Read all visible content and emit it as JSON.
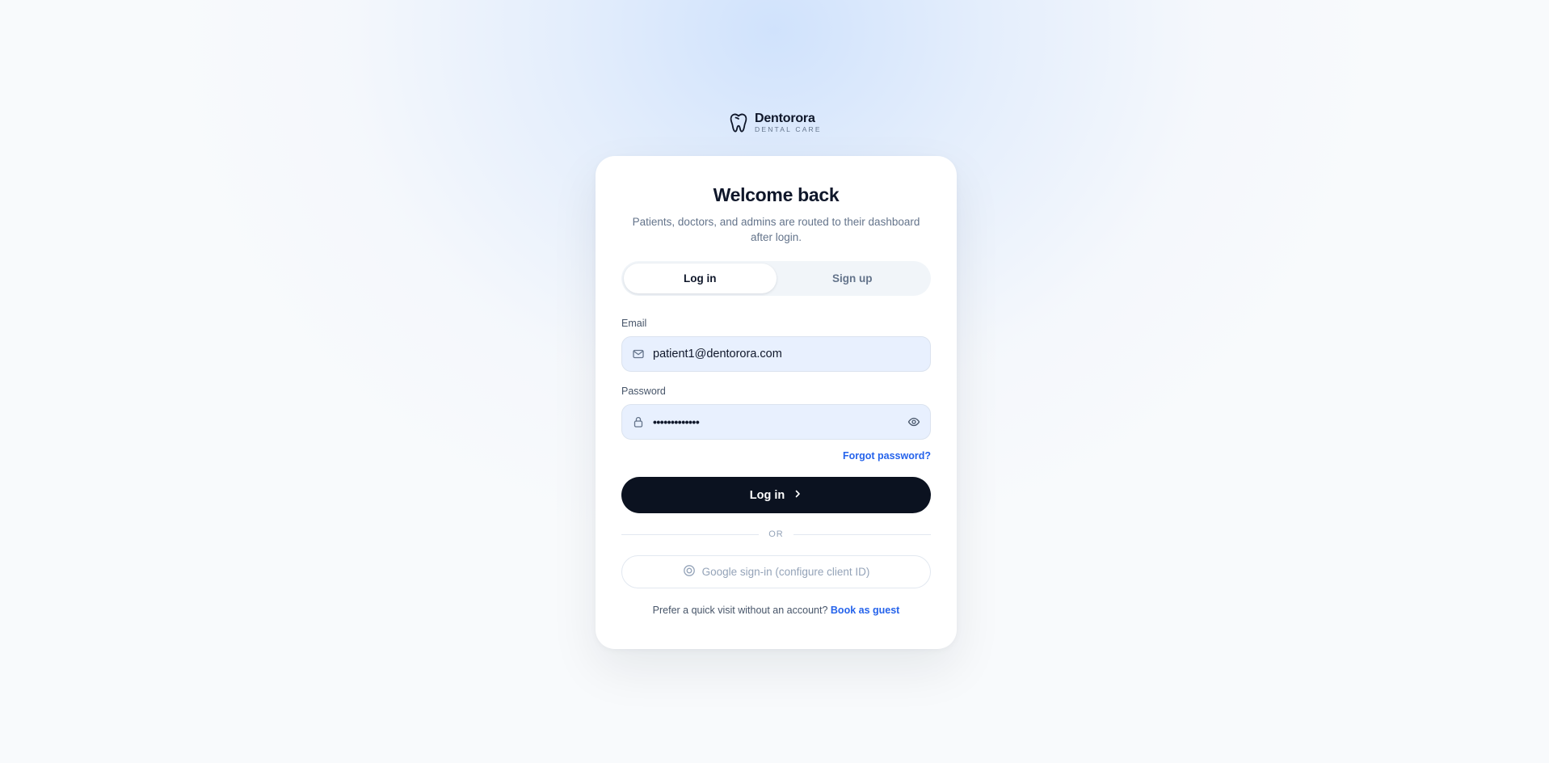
{
  "brand": {
    "name": "Dentorora",
    "tagline": "DENTAL CARE"
  },
  "card": {
    "title": "Welcome back",
    "subtitle": "Patients, doctors, and admins are routed to their dashboard after login."
  },
  "tabs": [
    {
      "label": "Log in",
      "active": true
    },
    {
      "label": "Sign up",
      "active": false
    }
  ],
  "form": {
    "email": {
      "label": "Email",
      "value": "patient1@dentorora.com"
    },
    "password": {
      "label": "Password",
      "masked": "•••••••••••••"
    },
    "forgot_label": "Forgot password?",
    "submit_label": "Log in"
  },
  "divider_label": "OR",
  "google_label": "Google sign-in (configure client ID)",
  "guest": {
    "prompt": "Prefer a quick visit without an account? ",
    "link_label": "Book as guest"
  },
  "colors": {
    "primary": "#0b1220",
    "accent": "#2563eb",
    "input_bg": "#e8f0fe"
  },
  "icons": {
    "brand": "tooth-icon",
    "email": "mail-icon",
    "password": "lock-icon",
    "toggle": "eye-icon",
    "submit": "chevron-right-icon",
    "google": "google-icon"
  }
}
